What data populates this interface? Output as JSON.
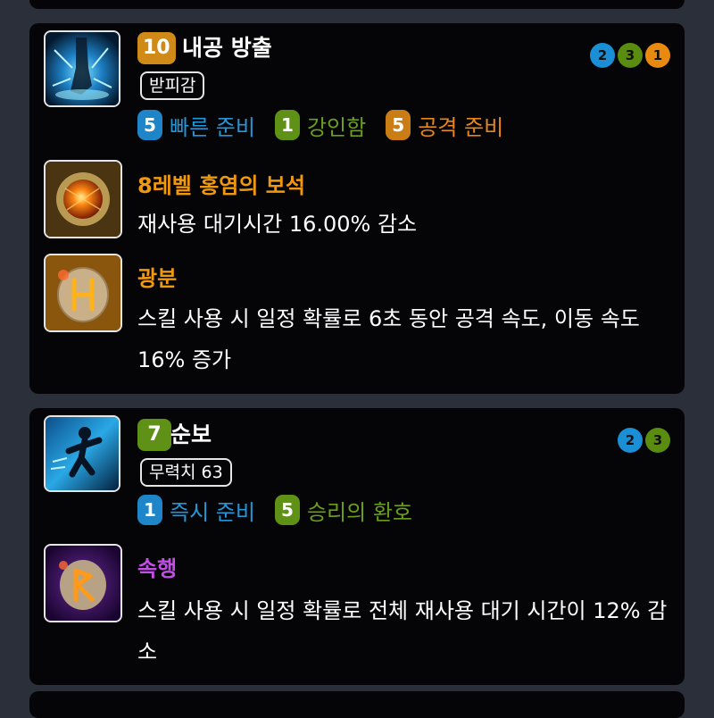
{
  "colors": {
    "blue": "#1a8fd6",
    "green": "#5a8c10",
    "orange": "#e88a10",
    "gold_text": "#f0980e",
    "purple_text": "#c44de8",
    "tripod_blue": "#2496d8",
    "tripod_green": "#6a9e1c",
    "tripod_orange": "#e8861a"
  },
  "skills": [
    {
      "level": "10",
      "name": "내공 방출",
      "tag": "받피감",
      "icon": "energy-release-icon",
      "tripods": [
        {
          "level": "5",
          "label": "빠른 준비",
          "color": "blue"
        },
        {
          "level": "1",
          "label": "강인함",
          "color": "green"
        },
        {
          "level": "5",
          "label": "공격 준비",
          "color": "orange"
        }
      ],
      "tier_dots": [
        "2",
        "3",
        "1"
      ],
      "gem": {
        "name": "8레벨 홍염의 보석",
        "desc": "재사용 대기시간 16.00% 감소",
        "icon": "flame-gem-icon"
      },
      "rune": {
        "name": "광분",
        "desc": "스킬 사용 시 일정 확률로 6초 동안 공격 속도, 이동 속도 16% 증가",
        "icon": "frenzy-rune-icon"
      }
    },
    {
      "level": "7",
      "name": "순보",
      "tag": "무력치 63",
      "icon": "flash-step-icon",
      "tripods": [
        {
          "level": "1",
          "label": "즉시 준비",
          "color": "blue"
        },
        {
          "level": "5",
          "label": "승리의 환호",
          "color": "green"
        }
      ],
      "tier_dots": [
        "2",
        "3"
      ],
      "rune": {
        "name": "속행",
        "desc": "스킬 사용 시 일정 확률로 전체 재사용 대기 시간이 12% 감소",
        "icon": "swiftness-rune-icon"
      }
    }
  ]
}
